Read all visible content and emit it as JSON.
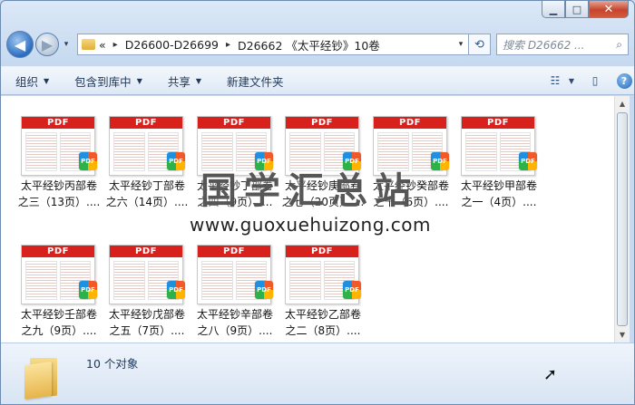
{
  "window": {
    "minimize_glyph": "▁",
    "maximize_glyph": "□",
    "close_glyph": "✕"
  },
  "nav": {
    "back_glyph": "◀",
    "forward_glyph": "▶",
    "history_glyph": "▾"
  },
  "address": {
    "overflow": "«",
    "crumbs": [
      "D26600-D26699",
      "D26662 《太平经钞》10卷"
    ],
    "separator": "▸",
    "refresh_glyph": "⟲"
  },
  "search": {
    "placeholder": "搜索 D26662 ...",
    "icon_glyph": "⌕"
  },
  "toolbar": {
    "organize": "组织",
    "include_library": "包含到库中",
    "share": "共享",
    "new_folder": "新建文件夹",
    "view_glyph": "☷",
    "pane_glyph": "▯",
    "help_glyph": "?"
  },
  "files": [
    {
      "line1": "太平经钞丙部卷",
      "line2": "之三（13页）...."
    },
    {
      "line1": "太平经钞丁部卷",
      "line2": "之六（14页）...."
    },
    {
      "line1": "太平经钞丁部卷",
      "line2": "之四（9页）...."
    },
    {
      "line1": "太平经钞庚部卷",
      "line2": "之七（20页）...."
    },
    {
      "line1": "太平经钞癸部卷",
      "line2": "之十（6页）...."
    },
    {
      "line1": "太平经钞甲部卷",
      "line2": "之一（4页）...."
    },
    {
      "line1": "太平经钞壬部卷",
      "line2": "之九（9页）...."
    },
    {
      "line1": "太平经钞戊部卷",
      "line2": "之五（7页）...."
    },
    {
      "line1": "太平经钞辛部卷",
      "line2": "之八（9页）...."
    },
    {
      "line1": "太平经钞乙部卷",
      "line2": "之二（8页）...."
    }
  ],
  "pdf_label": "PDF",
  "badge_label": "PDF",
  "watermark": {
    "title": "国学汇总站",
    "url": "www.guoxuehuizong.com"
  },
  "details": {
    "count": "10 个对象"
  },
  "scrollbar": {
    "up_glyph": "▲",
    "down_glyph": "▼"
  }
}
